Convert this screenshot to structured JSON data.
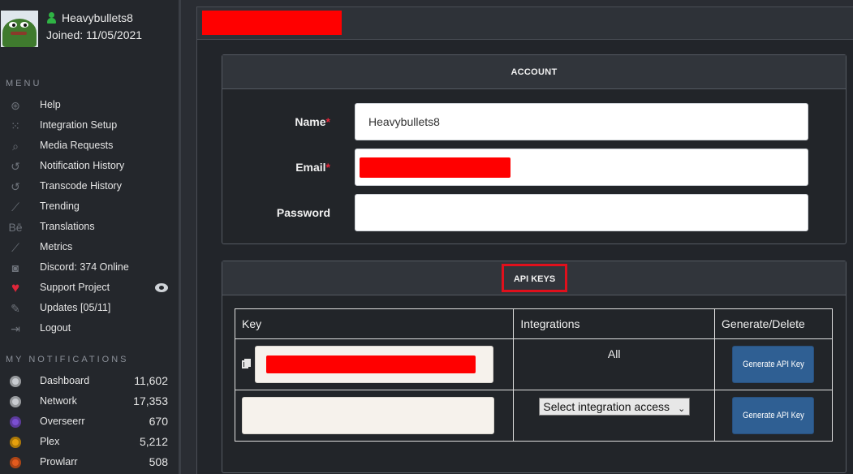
{
  "profile": {
    "username": "Heavybullets8",
    "joined": "Joined: 11/05/2021"
  },
  "menu": {
    "title": "MENU",
    "items": [
      {
        "label": "Help",
        "icon": "lifebuoy-icon",
        "glyph": "⊛"
      },
      {
        "label": "Integration Setup",
        "icon": "grid-icon",
        "glyph": "⁙"
      },
      {
        "label": "Media Requests",
        "icon": "search-icon",
        "glyph": "⌕"
      },
      {
        "label": "Notification History",
        "icon": "history-icon",
        "glyph": "↺"
      },
      {
        "label": "Transcode History",
        "icon": "history-icon",
        "glyph": "↺"
      },
      {
        "label": "Trending",
        "icon": "chart-line-icon",
        "glyph": "⟋"
      },
      {
        "label": "Translations",
        "icon": "behance-icon",
        "glyph": "Bē"
      },
      {
        "label": "Metrics",
        "icon": "chart-line-icon",
        "glyph": "⟋"
      },
      {
        "label": "Discord: 374 Online",
        "icon": "discord-icon",
        "glyph": "◙"
      },
      {
        "label": "Support Project",
        "icon": "heart-icon",
        "glyph": "♥"
      },
      {
        "label": "Updates [05/11]",
        "icon": "edit-icon",
        "glyph": "✎"
      },
      {
        "label": "Logout",
        "icon": "sign-out-icon",
        "glyph": "⇥"
      }
    ]
  },
  "notifications": {
    "title": "MY NOTIFICATIONS",
    "items": [
      {
        "label": "Dashboard",
        "count": "11,602",
        "icon": "dashboard-icon",
        "color": "#c9ccd1"
      },
      {
        "label": "Network",
        "count": "17,353",
        "icon": "network-icon",
        "color": "#c9ccd1"
      },
      {
        "label": "Overseerr",
        "count": "670",
        "icon": "overseerr-icon",
        "color": "#7b4fd1"
      },
      {
        "label": "Plex",
        "count": "5,212",
        "icon": "plex-icon",
        "color": "#e5a00d"
      },
      {
        "label": "Prowlarr",
        "count": "508",
        "icon": "prowlarr-icon",
        "color": "#e35b1e"
      }
    ]
  },
  "account": {
    "title": "ACCOUNT",
    "name_label": "Name",
    "name_value": "Heavybullets8",
    "email_label": "Email",
    "password_label": "Password",
    "required_mark": "*"
  },
  "api_keys": {
    "title": "API KEYS",
    "columns": [
      "Key",
      "Integrations",
      "Generate/Delete"
    ],
    "row1_integrations": "All",
    "generate_label": "Generate API Key",
    "select_placeholder": "Select integration access"
  },
  "colors": {
    "accent": "#2f5f93",
    "required": "#e0263a",
    "redaction": "#ff0000"
  }
}
